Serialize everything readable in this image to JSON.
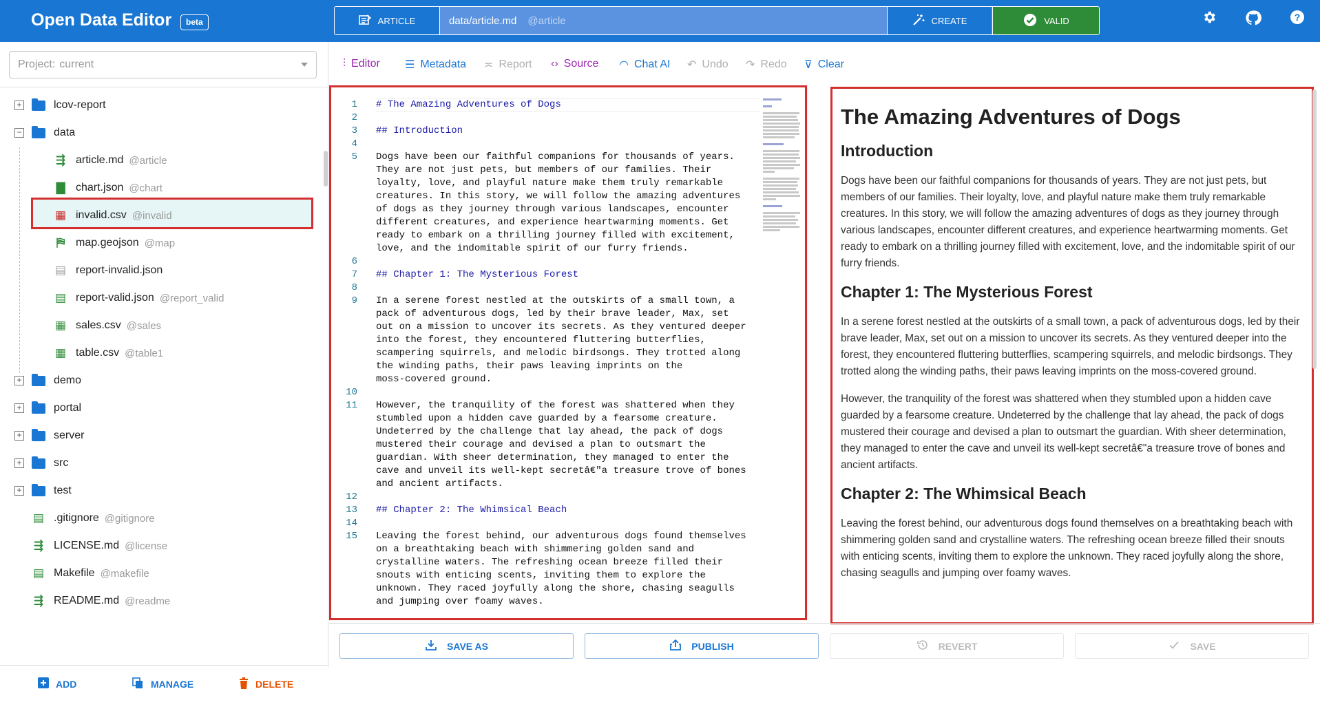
{
  "header": {
    "app_title": "Open Data Editor",
    "badge": "beta",
    "type_button": "ARTICLE",
    "path": "data/article.md",
    "path_alias": "@article",
    "create_button": "CREATE",
    "valid_button": "VALID"
  },
  "sidebar": {
    "project_label": "Project:",
    "project_value": "current",
    "tree": [
      {
        "name": "lcov-report",
        "alias": "",
        "kind": "folder",
        "expander": "+"
      },
      {
        "name": "data",
        "alias": "",
        "kind": "folder",
        "expander": "−"
      },
      {
        "name": "article.md",
        "alias": "@article",
        "kind": "article"
      },
      {
        "name": "chart.json",
        "alias": "@chart",
        "kind": "chart"
      },
      {
        "name": "invalid.csv",
        "alias": "@invalid",
        "kind": "table-invalid"
      },
      {
        "name": "map.geojson",
        "alias": "@map",
        "kind": "map"
      },
      {
        "name": "report-invalid.json",
        "alias": "",
        "kind": "file-gray"
      },
      {
        "name": "report-valid.json",
        "alias": "@report_valid",
        "kind": "file-green"
      },
      {
        "name": "sales.csv",
        "alias": "@sales",
        "kind": "table"
      },
      {
        "name": "table.csv",
        "alias": "@table1",
        "kind": "table"
      },
      {
        "name": "demo",
        "alias": "",
        "kind": "folder",
        "expander": "+"
      },
      {
        "name": "portal",
        "alias": "",
        "kind": "folder",
        "expander": "+"
      },
      {
        "name": "server",
        "alias": "",
        "kind": "folder",
        "expander": "+"
      },
      {
        "name": "src",
        "alias": "",
        "kind": "folder",
        "expander": "+"
      },
      {
        "name": "test",
        "alias": "",
        "kind": "folder",
        "expander": "+"
      },
      {
        "name": ".gitignore",
        "alias": "@gitignore",
        "kind": "file-green"
      },
      {
        "name": "LICENSE.md",
        "alias": "@license",
        "kind": "article"
      },
      {
        "name": "Makefile",
        "alias": "@makefile",
        "kind": "file-green"
      },
      {
        "name": "README.md",
        "alias": "@readme",
        "kind": "article"
      }
    ],
    "actions": {
      "add": "ADD",
      "manage": "MANAGE",
      "delete": "DELETE"
    }
  },
  "toolbar": {
    "editor": "Editor",
    "metadata": "Metadata",
    "report": "Report",
    "source": "Source",
    "chat_ai": "Chat AI",
    "undo": "Undo",
    "redo": "Redo",
    "clear": "Clear"
  },
  "editor": {
    "lines": [
      {
        "n": "1",
        "t": "# The Amazing Adventures of Dogs",
        "h": true
      },
      {
        "n": "2",
        "t": ""
      },
      {
        "n": "3",
        "t": "## Introduction",
        "h": true
      },
      {
        "n": "4",
        "t": ""
      },
      {
        "n": "5",
        "t": "Dogs have been our faithful companions for thousands of years."
      },
      {
        "n": "",
        "t": "They are not just pets, but members of our families. Their"
      },
      {
        "n": "",
        "t": "loyalty, love, and playful nature make them truly remarkable"
      },
      {
        "n": "",
        "t": "creatures. In this story, we will follow the amazing adventures"
      },
      {
        "n": "",
        "t": "of dogs as they journey through various landscapes, encounter"
      },
      {
        "n": "",
        "t": "different creatures, and experience heartwarming moments. Get"
      },
      {
        "n": "",
        "t": "ready to embark on a thrilling journey filled with excitement,"
      },
      {
        "n": "",
        "t": "love, and the indomitable spirit of our furry friends."
      },
      {
        "n": "6",
        "t": ""
      },
      {
        "n": "7",
        "t": "## Chapter 1: The Mysterious Forest",
        "h": true
      },
      {
        "n": "8",
        "t": ""
      },
      {
        "n": "9",
        "t": "In a serene forest nestled at the outskirts of a small town, a"
      },
      {
        "n": "",
        "t": "pack of adventurous dogs, led by their brave leader, Max, set"
      },
      {
        "n": "",
        "t": "out on a mission to uncover its secrets. As they ventured deeper"
      },
      {
        "n": "",
        "t": "into the forest, they encountered fluttering butterflies,"
      },
      {
        "n": "",
        "t": "scampering squirrels, and melodic birdsongs. They trotted along"
      },
      {
        "n": "",
        "t": "the winding paths, their paws leaving imprints on the"
      },
      {
        "n": "",
        "t": "moss-covered ground."
      },
      {
        "n": "10",
        "t": ""
      },
      {
        "n": "11",
        "t": "However, the tranquility of the forest was shattered when they"
      },
      {
        "n": "",
        "t": "stumbled upon a hidden cave guarded by a fearsome creature."
      },
      {
        "n": "",
        "t": "Undeterred by the challenge that lay ahead, the pack of dogs"
      },
      {
        "n": "",
        "t": "mustered their courage and devised a plan to outsmart the"
      },
      {
        "n": "",
        "t": "guardian. With sheer determination, they managed to enter the"
      },
      {
        "n": "",
        "t": "cave and unveil its well-kept secretâ€\"a treasure trove of bones"
      },
      {
        "n": "",
        "t": "and ancient artifacts."
      },
      {
        "n": "12",
        "t": ""
      },
      {
        "n": "13",
        "t": "## Chapter 2: The Whimsical Beach",
        "h": true
      },
      {
        "n": "14",
        "t": ""
      },
      {
        "n": "15",
        "t": "Leaving the forest behind, our adventurous dogs found themselves"
      },
      {
        "n": "",
        "t": "on a breathtaking beach with shimmering golden sand and"
      },
      {
        "n": "",
        "t": "crystalline waters. The refreshing ocean breeze filled their"
      },
      {
        "n": "",
        "t": "snouts with enticing scents, inviting them to explore the"
      },
      {
        "n": "",
        "t": "unknown. They raced joyfully along the shore, chasing seagulls"
      },
      {
        "n": "",
        "t": "and jumping over foamy waves."
      }
    ]
  },
  "preview": {
    "title": "The Amazing Adventures of Dogs",
    "intro_heading": "Introduction",
    "intro_text": "Dogs have been our faithful companions for thousands of years. They are not just pets, but members of our families. Their loyalty, love, and playful nature make them truly remarkable creatures. In this story, we will follow the amazing adventures of dogs as they journey through various landscapes, encounter different creatures, and experience heartwarming moments. Get ready to embark on a thrilling journey filled with excitement, love, and the indomitable spirit of our furry friends.",
    "ch1_heading": "Chapter 1: The Mysterious Forest",
    "ch1_p1": "In a serene forest nestled at the outskirts of a small town, a pack of adventurous dogs, led by their brave leader, Max, set out on a mission to uncover its secrets. As they ventured deeper into the forest, they encountered fluttering butterflies, scampering squirrels, and melodic birdsongs. They trotted along the winding paths, their paws leaving imprints on the moss-covered ground.",
    "ch1_p2": "However, the tranquility of the forest was shattered when they stumbled upon a hidden cave guarded by a fearsome creature. Undeterred by the challenge that lay ahead, the pack of dogs mustered their courage and devised a plan to outsmart the guardian. With sheer determination, they managed to enter the cave and unveil its well-kept secretâ€\"a treasure trove of bones and ancient artifacts.",
    "ch2_heading": "Chapter 2: The Whimsical Beach",
    "ch2_p1": "Leaving the forest behind, our adventurous dogs found themselves on a breathtaking beach with shimmering golden sand and crystalline waters. The refreshing ocean breeze filled their snouts with enticing scents, inviting them to explore the unknown. They raced joyfully along the shore, chasing seagulls and jumping over foamy waves."
  },
  "bottom": {
    "save_as": "SAVE AS",
    "publish": "PUBLISH",
    "revert": "REVERT",
    "save": "SAVE"
  },
  "colors": {
    "brand": "#1976d2",
    "valid": "#2e8b38",
    "selection_outline": "#d32f2f",
    "delete": "#e65100",
    "toolbar_purple": "#9c27b0"
  }
}
